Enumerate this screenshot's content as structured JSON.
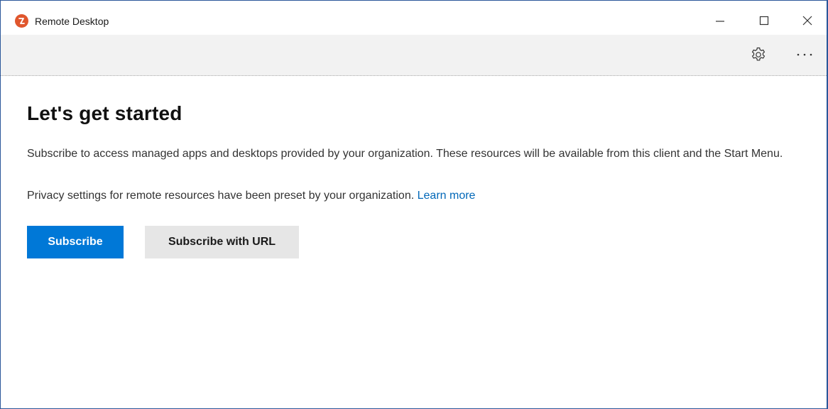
{
  "window": {
    "title": "Remote Desktop",
    "controls": {
      "minimize_icon": "minimize-icon",
      "maximize_icon": "maximize-icon",
      "close_icon": "close-icon"
    }
  },
  "commandbar": {
    "settings_icon": "gear-icon",
    "more_icon": "more-icon"
  },
  "main": {
    "title": "Let's get started",
    "description": "Subscribe to access managed apps and desktops provided by your organization. These resources will be available from this client and the Start Menu.",
    "privacy_text": "Privacy settings for remote resources have been preset by your organization.",
    "learn_more": "Learn more",
    "buttons": {
      "subscribe": "Subscribe",
      "subscribe_url": "Subscribe with URL"
    }
  },
  "colors": {
    "accent": "#0078d7",
    "link": "#0067b8",
    "logo": "#e0562d",
    "window_border": "#2b579a",
    "commandbar_bg": "#f2f2f2",
    "secondary_button_bg": "#e6e6e6"
  }
}
